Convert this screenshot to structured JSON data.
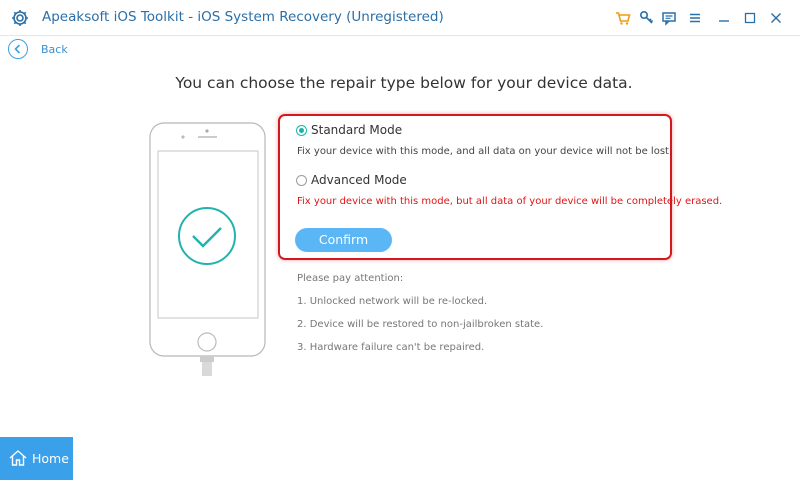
{
  "window": {
    "title": "Apeaksoft iOS Toolkit - iOS System Recovery (Unregistered)",
    "app_icon": "gear-icon",
    "controls": [
      "cart-icon",
      "key-icon",
      "feedback-icon",
      "menu-icon",
      "minimize-icon",
      "maximize-icon",
      "close-icon"
    ],
    "accent_color": "#3aa0ea"
  },
  "nav": {
    "back_label": "Back",
    "home_label": "Home"
  },
  "main": {
    "headline": "You can choose the repair type below for your device data.",
    "options": [
      {
        "label": "Standard Mode",
        "description": "Fix your device with this mode, and all data on your device will not be lost.",
        "selected": true
      },
      {
        "label": "Advanced Mode",
        "description": "Fix your device with this mode, but all data of your device will be completely erased.",
        "selected": false
      }
    ],
    "confirm_label": "Confirm",
    "attention_title": "Please pay attention:",
    "notes": [
      "1. Unlocked network will be re-locked.",
      "2. Device will be restored to non-jailbroken state.",
      "3. Hardware failure can't be repaired."
    ]
  }
}
